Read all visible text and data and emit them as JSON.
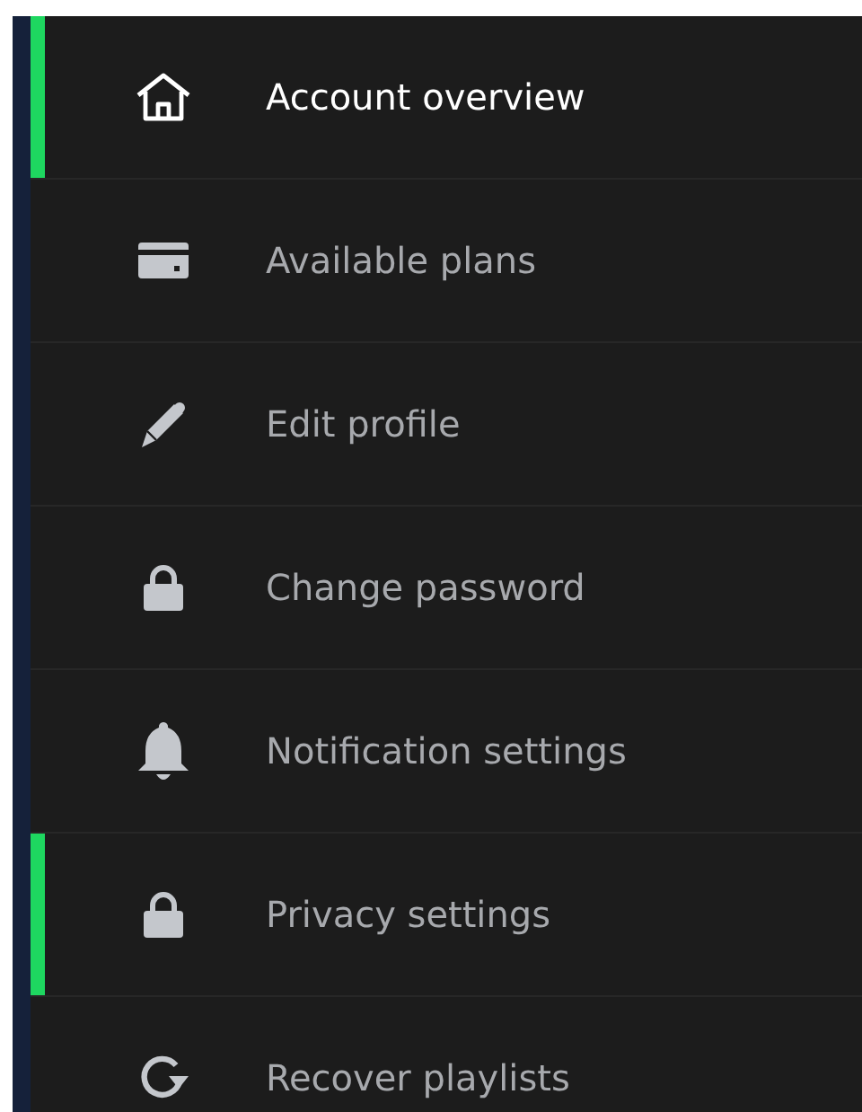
{
  "menu": {
    "items": [
      {
        "label": "Account overview",
        "kind": "home",
        "selected": true,
        "current": true
      },
      {
        "label": "Available plans",
        "kind": "card",
        "selected": false,
        "current": false
      },
      {
        "label": "Edit profile",
        "kind": "pencil",
        "selected": false,
        "current": false
      },
      {
        "label": "Change password",
        "kind": "lock",
        "selected": false,
        "current": false
      },
      {
        "label": "Notification settings",
        "kind": "bell",
        "selected": false,
        "current": false
      },
      {
        "label": "Privacy settings",
        "kind": "lock",
        "selected": true,
        "current": false
      },
      {
        "label": "Recover playlists",
        "kind": "refresh",
        "selected": false,
        "current": false
      }
    ]
  }
}
